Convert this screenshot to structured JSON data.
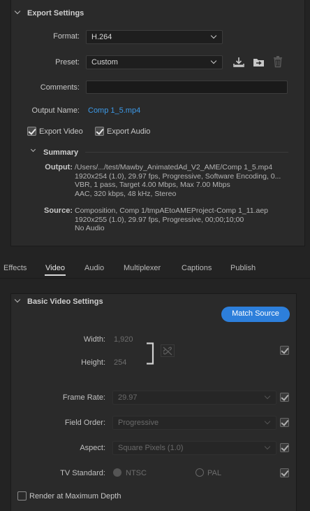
{
  "export_settings": {
    "title": "Export Settings",
    "format_label": "Format:",
    "format_value": "H.264",
    "preset_label": "Preset:",
    "preset_value": "Custom",
    "comments_label": "Comments:",
    "comments_value": "",
    "output_name_label": "Output Name:",
    "output_name_value": "Comp 1_5.mp4",
    "export_video_label": "Export Video",
    "export_video_checked": true,
    "export_audio_label": "Export Audio",
    "export_audio_checked": true,
    "summary": {
      "title": "Summary",
      "output_key": "Output:",
      "output_lines": [
        "/Users/.../test/Mawby_AnimatedAd_V2_AME/Comp 1_5.mp4",
        "1920x254 (1.0), 29.97 fps, Progressive, Software Encoding, 0...",
        "VBR, 1 pass, Target 4.00 Mbps, Max 7.00 Mbps",
        "AAC, 320 kbps, 48 kHz, Stereo"
      ],
      "source_key": "Source:",
      "source_lines": [
        "Composition, Comp 1/tmpAEtoAMEProject-Comp 1_11.aep",
        "1920x255 (1.0), 29.97 fps, Progressive, 00;00;10;00",
        "No Audio"
      ]
    }
  },
  "tabs": {
    "effects": "Effects",
    "video": "Video",
    "audio": "Audio",
    "multiplexer": "Multiplexer",
    "captions": "Captions",
    "publish": "Publish",
    "active": "Video"
  },
  "video": {
    "title": "Basic Video Settings",
    "match_source": "Match Source",
    "width_label": "Width:",
    "width_value": "1,920",
    "height_label": "Height:",
    "height_value": "254",
    "frame_rate_label": "Frame Rate:",
    "frame_rate_value": "29.97",
    "field_order_label": "Field Order:",
    "field_order_value": "Progressive",
    "aspect_label": "Aspect:",
    "aspect_value": "Square Pixels (1.0)",
    "tv_standard_label": "TV Standard:",
    "ntsc_label": "NTSC",
    "pal_label": "PAL",
    "render_max_depth_label": "Render at Maximum Depth"
  },
  "colors": {
    "accent": "#2d7fdb",
    "link": "#3d9ae8",
    "panel": "#2a2a2a",
    "background": "#232323"
  }
}
